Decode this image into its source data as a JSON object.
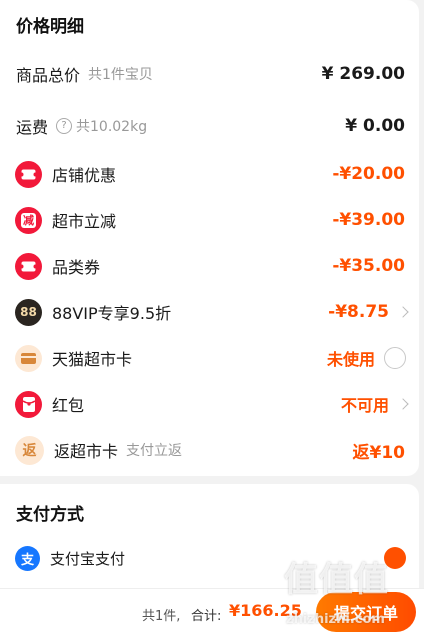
{
  "price_detail": {
    "title": "价格明细",
    "goods_total": {
      "label": "商品总价",
      "sub": "共1件宝贝",
      "value": "¥ 269.00"
    },
    "shipping": {
      "label": "运费",
      "sub": "共10.02kg",
      "value": "¥ 0.00"
    },
    "discounts": [
      {
        "label": "店铺优惠",
        "value": "-¥20.00",
        "icon": "ticket-icon"
      },
      {
        "label": "超市立减",
        "value": "-¥39.00",
        "icon": "reduce-icon",
        "icon_text": "减"
      },
      {
        "label": "品类券",
        "value": "-¥35.00",
        "icon": "ticket-icon"
      },
      {
        "label": "88VIP专享9.5折",
        "value": "-¥8.75",
        "icon": "vip88-icon",
        "icon_text": "88"
      },
      {
        "label": "天猫超市卡",
        "value": "未使用",
        "icon": "card-icon"
      },
      {
        "label": "红包",
        "value": "不可用",
        "icon": "red-packet-icon"
      },
      {
        "label": "返超市卡",
        "sub": "支付立返",
        "value": "返¥10",
        "icon": "rebate-icon",
        "icon_text": "返"
      }
    ]
  },
  "payment": {
    "title": "支付方式",
    "method": {
      "label": "支付宝支付",
      "icon": "alipay-icon",
      "icon_text": "支"
    }
  },
  "footer": {
    "count": "共1件,",
    "total_label": "合计:",
    "total_value": "¥166.25",
    "submit_label": "提交订单"
  },
  "watermark": {
    "logo": "值值值",
    "site": "zhizhizhi.com"
  },
  "colors": {
    "accent": "#ff5000",
    "red_icon": "#f2193a",
    "alipay": "#1677ff"
  }
}
